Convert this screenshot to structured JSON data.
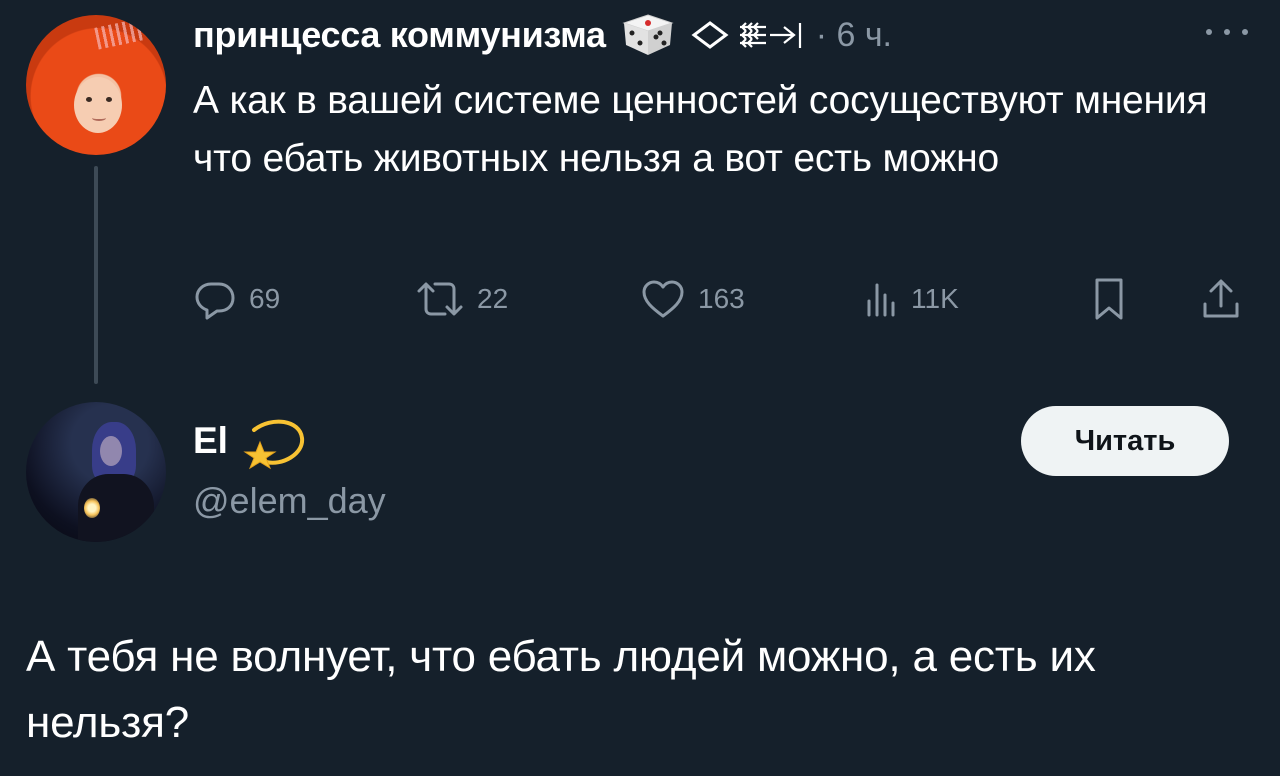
{
  "parent_tweet": {
    "author_name": "принцесса коммунизма",
    "time": "· 6 ч.",
    "text": "А как в вашей системе ценностей сосуществуют мнения что ебать животных нельзя а вот есть можно",
    "badges": [
      "dice-emoji-icon",
      "diamond-icon",
      "arrows-glyph-icon"
    ],
    "actions": {
      "replies": "69",
      "reposts": "22",
      "likes": "163",
      "views": "11K"
    }
  },
  "reply_author": {
    "name": "El",
    "badge": "dizzy-star-emoji-icon",
    "handle": "@elem_day",
    "follow_label": "Читать"
  },
  "reply_tweet": {
    "text": "А тебя не волнует, что ебать людей можно, а есть их нельзя?"
  },
  "colors": {
    "background": "#15202b",
    "text_primary": "#ffffff",
    "text_secondary": "#8b98a5",
    "button_bg": "#eff3f4"
  }
}
